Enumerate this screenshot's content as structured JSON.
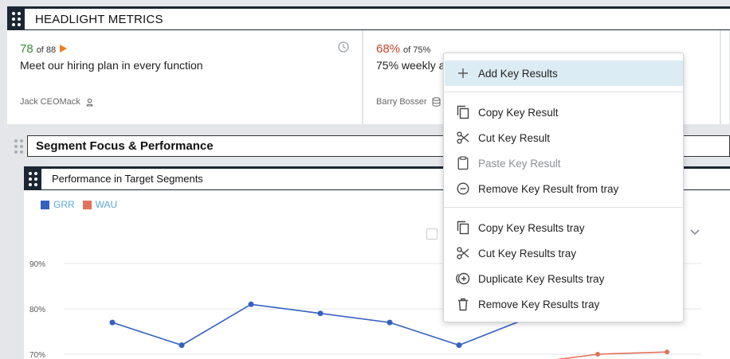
{
  "headlight": {
    "title": "HEADLIGHT METRICS"
  },
  "cards": [
    {
      "value": "78",
      "of": "of 88",
      "description": "Meet our hiring plan in every function",
      "owner": "Jack CEOMack"
    },
    {
      "value": "68%",
      "of": "of 75%",
      "description": "75% weekly a",
      "owner": "Barry Bosser"
    }
  ],
  "section": {
    "title": "Segment Focus & Performance"
  },
  "widget": {
    "title": "Performance in Target Segments"
  },
  "legend": [
    {
      "label": "GRR",
      "color": "#3461c1"
    },
    {
      "label": "WAU",
      "color": "#e0735c"
    }
  ],
  "chart_data": {
    "type": "line",
    "ylabels": [
      "90%",
      "80%",
      "70%"
    ],
    "series": [
      {
        "name": "GRR",
        "color": "#3461c1",
        "values": [
          77,
          72,
          81,
          79,
          77,
          72,
          78
        ]
      },
      {
        "name": "WAU",
        "color": "#e0735c",
        "values": [
          68,
          70,
          70.5
        ]
      }
    ]
  },
  "menu": {
    "add": "Add Key Results",
    "copy": "Copy Key Result",
    "cut": "Cut Key Result",
    "paste": "Paste Key Result",
    "remove_from_tray": "Remove Key Result from tray",
    "copy_tray": "Copy Key Results tray",
    "cut_tray": "Cut Key Results tray",
    "duplicate_tray": "Duplicate Key Results tray",
    "remove_tray": "Remove Key Results tray"
  },
  "colors": {
    "accent_dark": "#1c2633",
    "green": "#3a8e3a",
    "red": "#c9452a",
    "menu_highlight": "#dcecf4"
  }
}
